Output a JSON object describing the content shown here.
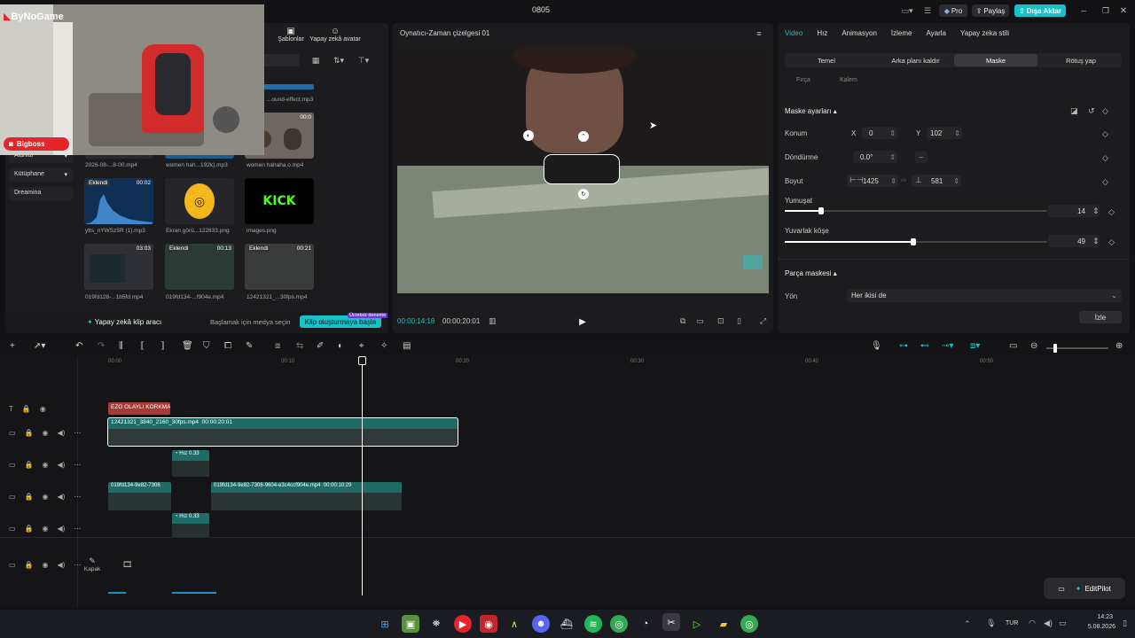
{
  "window": {
    "title": "0805"
  },
  "topbar": {
    "pro": "Pro",
    "share": "Paylaş",
    "export": "Dışa Aktar"
  },
  "overlay": {
    "logo": "ByNoGame",
    "streamer": "Bigboss"
  },
  "left_panel": {
    "tabs": [
      "Şablonlar",
      "Yapay zekâ avatar"
    ],
    "nav": [
      "Alanlar",
      "Kütüphane",
      "Dreamina"
    ],
    "media": [
      {
        "name": "...ound-effect.mp3",
        "duration": "",
        "badge": ""
      },
      {
        "name": "2026-08-...8-00.mp4",
        "duration": "",
        "badge": ""
      },
      {
        "name": "women hah...192k).mp3",
        "duration": "",
        "badge": ""
      },
      {
        "name": "women hahaha o.mp4",
        "duration": "00:0",
        "badge": ""
      },
      {
        "name": "ytts_nYWSz5R (1).mp3",
        "duration": "00:02",
        "badge": "Eklendi"
      },
      {
        "name": "Ekran görü...122833.png",
        "duration": "",
        "badge": ""
      },
      {
        "name": "images.png",
        "duration": "",
        "badge": ""
      },
      {
        "name": "019fd128-...1b5fd.mp4",
        "duration": "03:03",
        "badge": ""
      },
      {
        "name": "019fd134-...f904e.mp4",
        "duration": "00:13",
        "badge": "Eklendi"
      },
      {
        "name": "12421321_...30fps.mp4",
        "duration": "00:21",
        "badge": "Eklendi"
      }
    ],
    "kick_label": "KICK",
    "ai_clip": "Yapay zekâ klip aracı",
    "hint": "Başlamak için medya seçin",
    "cta": "Klip oluşturmaya başla",
    "cta_tag": "Ücretsiz deneme"
  },
  "player": {
    "title": "Oynatıcı-Zaman çizelgesi 01",
    "current_time": "00:00:14:18",
    "total_time": "00:00:20:01"
  },
  "right_panel": {
    "tabs": [
      "Video",
      "Hız",
      "Animasyon",
      "İzleme",
      "Ayarla",
      "Yapay zeka stili"
    ],
    "subtabs": [
      "Temel",
      "Arka planı kaldır",
      "Maske",
      "Rötuş yap"
    ],
    "subtabs2": [
      "Fırça",
      "Kalem"
    ],
    "section_mask": "Maske ayarları",
    "position_label": "Konum",
    "x_label": "X",
    "x_value": "0",
    "y_label": "Y",
    "y_value": "102",
    "rotation_label": "Döndürme",
    "rotation_value": "0.0°",
    "size_label": "Boyut",
    "width_value": "1425",
    "height_value": "581",
    "feather_label": "Yumuşat",
    "feather_value": "14",
    "feather_level": 0.14,
    "round_label": "Yuvarlak köşe",
    "round_value": "49",
    "round_level": 0.49,
    "part_mask": "Parça maskesi",
    "direction_label": "Yön",
    "direction_value": "Her ikisi de",
    "track_button": "İzle"
  },
  "timeline": {
    "ruler": [
      "00:00",
      "00:10",
      "00:20",
      "00:30",
      "00:40",
      "00:50"
    ],
    "text_clip": "EZO OLAYLI KORKMA",
    "main_clip": "12421321_3840_2160_30fps.mp4",
    "main_clip_duration": "00:00:20:01",
    "speed_label": "Hız 0.33",
    "clip_a": "019fd134-9e82-7306",
    "clip_b": "019fd134-9e82-7306-9604-e3c4ccf904e.mp4",
    "clip_b_duration": "00:00:10:29",
    "cover": "Kapak",
    "editpilot": "EditPilot"
  },
  "taskbar": {
    "lang": "TUR",
    "time": "14:23",
    "date": "5.08.2026"
  },
  "colors": {
    "accent": "#16c1c8",
    "clip": "#1f6b66",
    "text_clip": "#a63b35",
    "live": "#e5252a"
  }
}
